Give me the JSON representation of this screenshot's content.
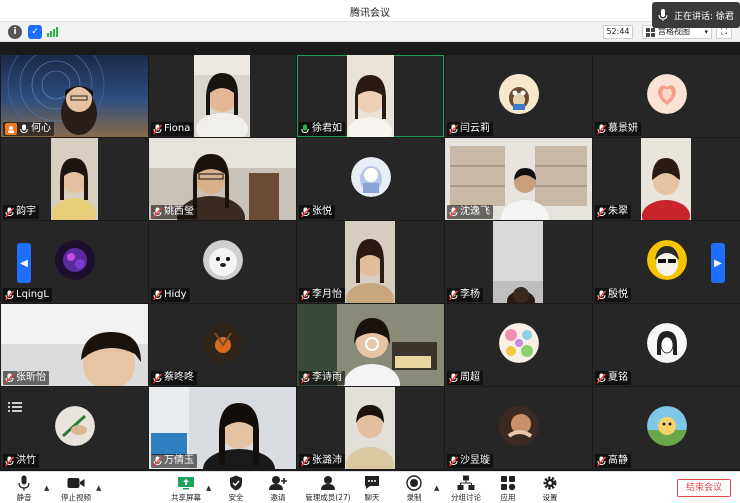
{
  "window": {
    "title": "腾讯会议"
  },
  "speaking": {
    "label": "正在讲话: 徐君"
  },
  "infobar": {
    "timer": "52:44",
    "view_label": "宫格视图"
  },
  "participants": [
    {
      "name": "何心",
      "host": true,
      "mic": "on"
    },
    {
      "name": "Fiona",
      "mic": "off"
    },
    {
      "name": "徐君如",
      "mic": "on",
      "active": true
    },
    {
      "name": "闫云莉",
      "mic": "off"
    },
    {
      "name": "慕景妍",
      "mic": "off"
    },
    {
      "name": "韵宇",
      "mic": "off"
    },
    {
      "name": "姚西瑩",
      "mic": "off"
    },
    {
      "name": "张悦",
      "mic": "off"
    },
    {
      "name": "沈逸飞",
      "mic": "off"
    },
    {
      "name": "朱翠",
      "mic": "off"
    },
    {
      "name": "LqingL",
      "mic": "off"
    },
    {
      "name": "Hidy",
      "mic": "off"
    },
    {
      "name": "李月怡",
      "mic": "off"
    },
    {
      "name": "李杨",
      "mic": "off"
    },
    {
      "name": "殷悦",
      "mic": "off"
    },
    {
      "name": "张昕怡",
      "mic": "off"
    },
    {
      "name": "蔡咚咚",
      "mic": "off"
    },
    {
      "name": "李诗雨",
      "mic": "off"
    },
    {
      "name": "周超",
      "mic": "off"
    },
    {
      "name": "夏铭",
      "mic": "off"
    },
    {
      "name": "洪竹",
      "mic": "off"
    },
    {
      "name": "万倩玉",
      "mic": "off"
    },
    {
      "name": "张潞沛",
      "mic": "off"
    },
    {
      "name": "沙昱璇",
      "mic": "off"
    },
    {
      "name": "高静",
      "mic": "off"
    }
  ],
  "toolbar": {
    "mute": "静音",
    "stop_video": "停止视频",
    "share_screen": "共享屏幕",
    "security": "安全",
    "invite": "邀请",
    "manage_members": "管理成员(27)",
    "chat": "聊天",
    "record": "录制",
    "breakout": "分组讨论",
    "apps": "应用",
    "settings": "设置",
    "end_meeting": "结束会议"
  },
  "colors": {
    "accent": "#1e6fff",
    "danger": "#e24a4a",
    "host": "#f07b23",
    "active_border": "#1f9d55"
  }
}
